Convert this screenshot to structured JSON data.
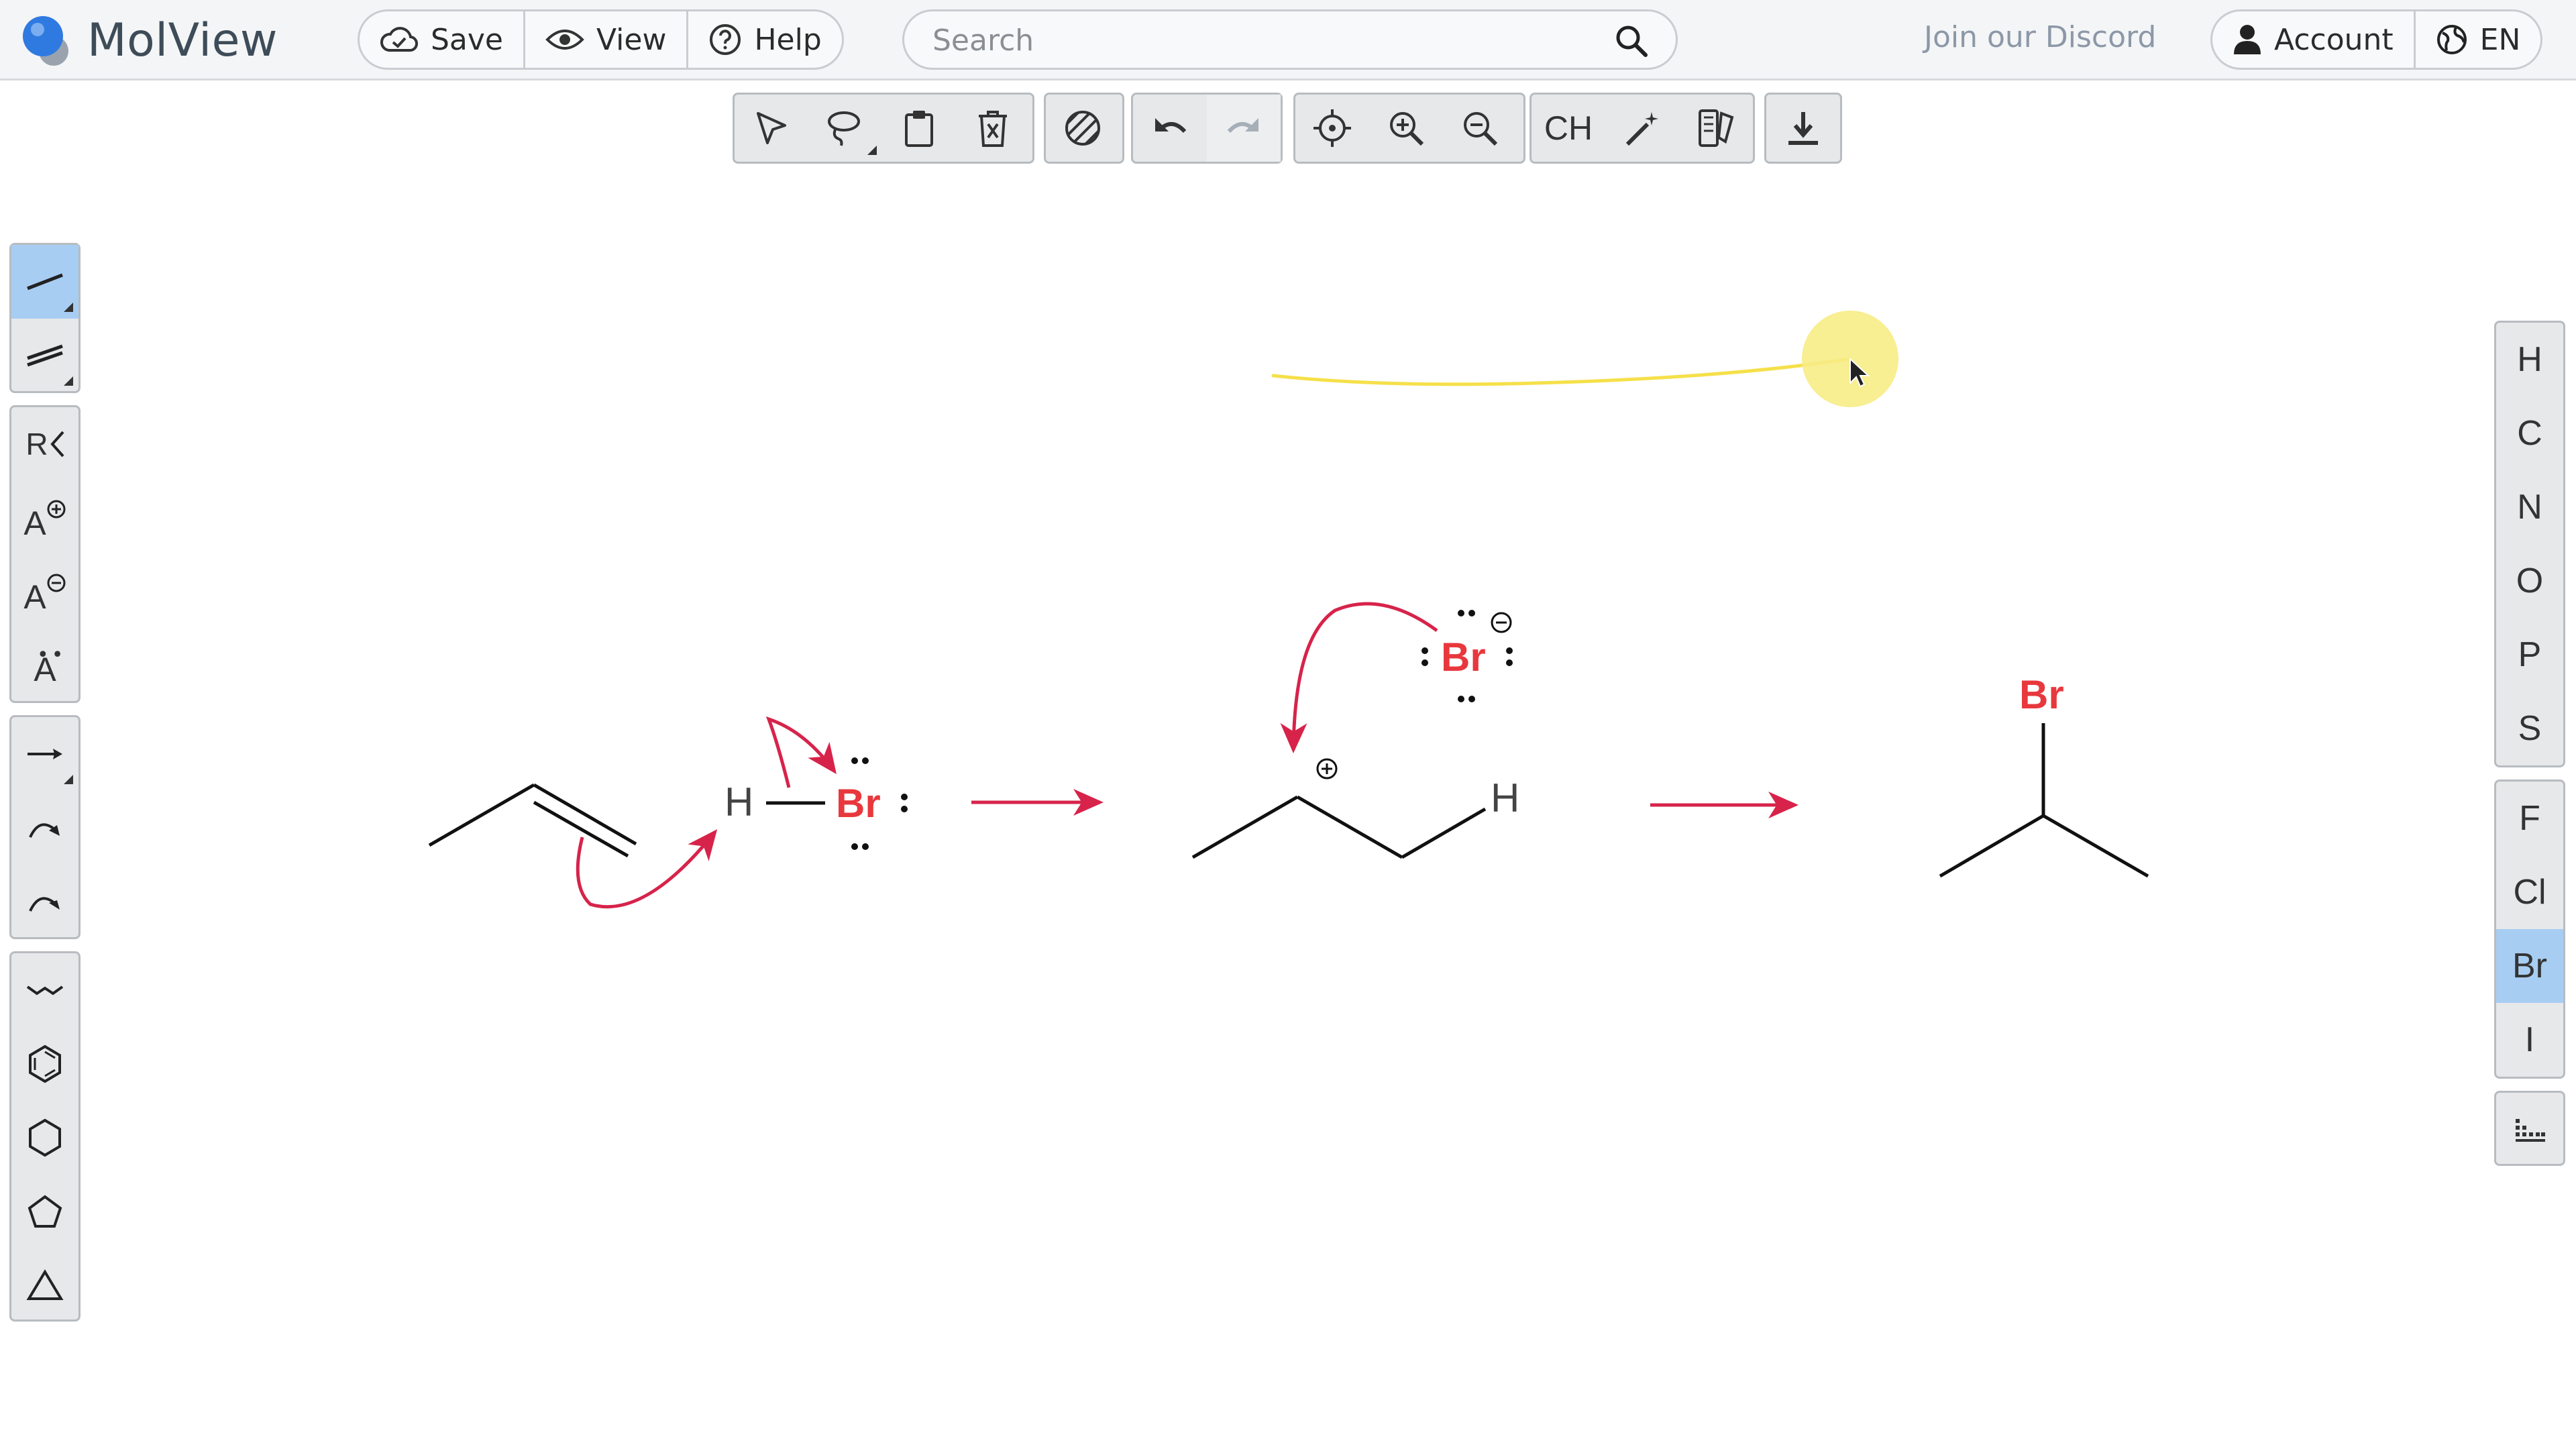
{
  "app": {
    "name": "MolView"
  },
  "header": {
    "buttons": [
      {
        "id": "save",
        "label": "Save"
      },
      {
        "id": "view",
        "label": "View"
      },
      {
        "id": "help",
        "label": "Help"
      }
    ],
    "search": {
      "placeholder": "Search",
      "value": ""
    },
    "discord_link": "Join our Discord",
    "account_label": "Account",
    "language_label": "EN"
  },
  "toolbar": {
    "groups": [
      [
        "select-icon",
        "lasso-icon",
        "clipboard-icon",
        "delete-icon"
      ],
      [
        "erase-all-icon"
      ],
      [
        "undo-icon",
        "redo-icon"
      ],
      [
        "center-icon",
        "zoom-in-icon",
        "zoom-out-icon"
      ],
      [
        "hydrogen-toggle",
        "clean-wand-icon",
        "template-icon"
      ],
      [
        "download-icon"
      ]
    ],
    "hydrogen_label": "CH",
    "redo_disabled": true
  },
  "left_tools": {
    "groups": [
      [
        "single-bond-icon",
        "double-bond-icon"
      ],
      [
        "r-group-icon",
        "positive-charge-icon",
        "negative-charge-icon",
        "lone-pair-icon"
      ],
      [
        "reaction-arrow-icon",
        "curved-arrow-icon",
        "curved-arrow-half-icon"
      ],
      [
        "chain-icon",
        "benzene-icon",
        "cyclohexane-icon",
        "cyclopentane-icon",
        "cyclopropane-icon"
      ]
    ],
    "active_tool": "single-bond-icon",
    "r_group_label": "R",
    "atom_charge_label": "A"
  },
  "right_elements": {
    "groups": [
      [
        "H",
        "C",
        "N",
        "O",
        "P",
        "S"
      ],
      [
        "F",
        "Cl",
        "Br",
        "I"
      ]
    ],
    "active": "Br",
    "periodic_table_icon": "periodic-table-icon"
  },
  "canvas": {
    "atom_labels": {
      "h_left": "H",
      "br_left": "Br",
      "br_anion": "Br",
      "h_cation": "H",
      "br_product": "Br"
    },
    "colors": {
      "halogen": "#e8383d",
      "arrow": "#d7234a",
      "bond": "#111111",
      "highlight_stroke": "#f5e04a",
      "cursor_halo": "#f7ec86"
    }
  },
  "colors": {
    "header_bg": "#f4f5f6",
    "toolbar_bg": "#e6e8ea",
    "active_tool": "#a8cdf3",
    "discord_link": "#8c98a8"
  }
}
